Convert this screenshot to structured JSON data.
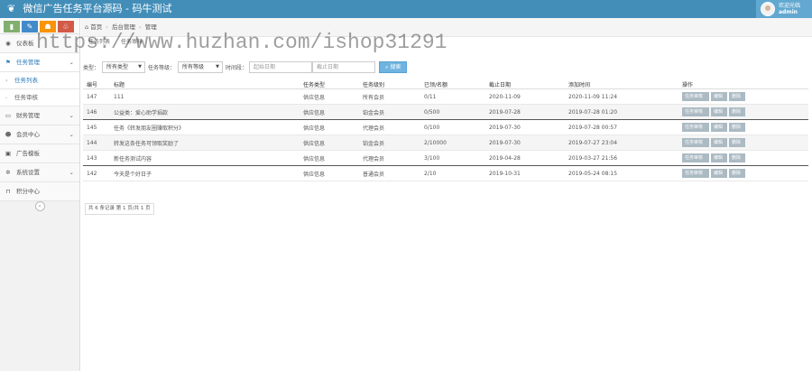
{
  "header": {
    "title": "微信广告任务平台源码 - 码牛测试",
    "welcome": "欢迎光临",
    "username": "admin"
  },
  "watermark": "https://www.huzhan.com/ishop31291",
  "sidebar": {
    "collapse_icon": "«",
    "items": [
      {
        "label": "仪表板",
        "icon": "dashboard-icon"
      },
      {
        "label": "任务管理",
        "icon": "flag-icon"
      },
      {
        "label": "任务列表",
        "icon": "arrow-right-icon"
      },
      {
        "label": "任务审核",
        "icon": "dot-icon"
      },
      {
        "label": "财务管理",
        "icon": "card-icon"
      },
      {
        "label": "会员中心",
        "icon": "user-icon"
      },
      {
        "label": "广告模板",
        "icon": "picture-icon"
      },
      {
        "label": "系统设置",
        "icon": "gear-icon"
      },
      {
        "label": "积分中心",
        "icon": "bookmark-icon"
      }
    ]
  },
  "breadcrumb": {
    "home": "首页",
    "section": "后台管理",
    "page": "管理"
  },
  "tabs": [
    "任务列表",
    "任务审核"
  ],
  "filter": {
    "type_label": "类型：",
    "type_value": "所有类型",
    "level_label": "任务等级：",
    "level_value": "所有等级",
    "time_label": "时间段：",
    "start_placeholder": "起始日期",
    "end_placeholder": "截止日期",
    "search_button": "搜索"
  },
  "table": {
    "headers": [
      "编号",
      "标题",
      "任务类型",
      "任务级别",
      "已领/名额",
      "截止日期",
      "添加时间",
      "操作"
    ],
    "rows": [
      {
        "id": "147",
        "title": "111",
        "type": "供应信息",
        "level": "所有会员",
        "count": "0/11",
        "deadline": "2020-11-09",
        "added": "2020-11-09 11:24"
      },
      {
        "id": "146",
        "title": "公益类：爱心助学捐款",
        "type": "供应信息",
        "level": "铂金会员",
        "count": "0/500",
        "deadline": "2019-07-28",
        "added": "2019-07-28 01:20"
      },
      {
        "id": "145",
        "title": "任务《转发朋友圈赚取积分》",
        "type": "供应信息",
        "level": "代理会员",
        "count": "0/100",
        "deadline": "2019-07-30",
        "added": "2019-07-28 00:57"
      },
      {
        "id": "144",
        "title": "转发这条任务可领取奖励了",
        "type": "供应信息",
        "level": "铂金会员",
        "count": "2/10000",
        "deadline": "2019-07-30",
        "added": "2019-07-27 23:04"
      },
      {
        "id": "143",
        "title": "新任务测试内容",
        "type": "供应信息",
        "level": "代理会员",
        "count": "3/100",
        "deadline": "2019-04-28",
        "added": "2019-03-27 21:56"
      },
      {
        "id": "142",
        "title": "今天是个好日子",
        "type": "供应信息",
        "level": "普通会员",
        "count": "2/10",
        "deadline": "2019-10-31",
        "added": "2019-05-24 08:15"
      }
    ],
    "actions": [
      "任务审核",
      "编辑",
      "删除"
    ]
  },
  "pager": "共 6 条记录 第 1 页/共 1 页",
  "colors": {
    "topbar": "#438eb9",
    "accent": "#2b7dbc",
    "action": "#abbac3"
  }
}
